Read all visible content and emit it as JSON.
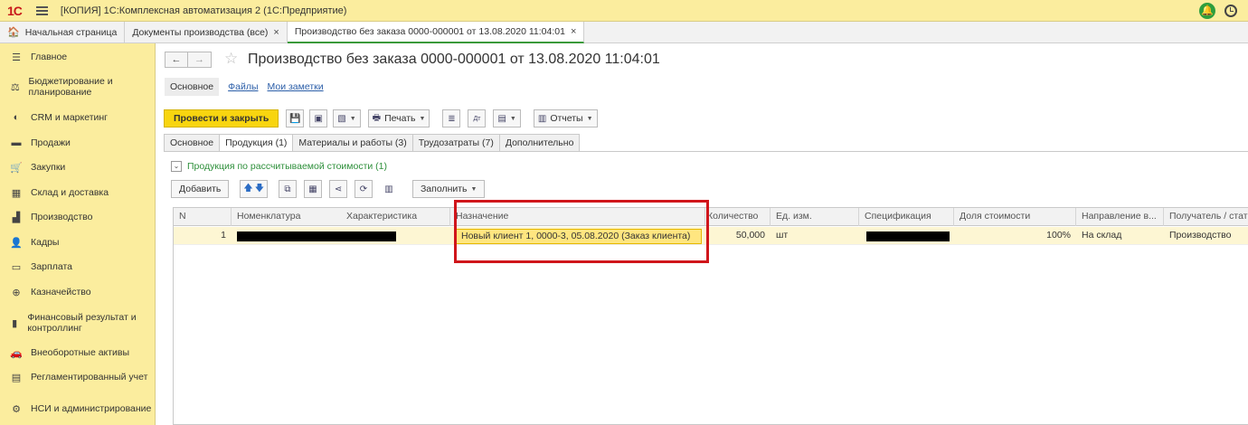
{
  "titlebar": {
    "logo": "1С",
    "title": "[КОПИЯ] 1С:Комплексная автоматизация 2  (1С:Предприятие)"
  },
  "window_tabs": [
    {
      "label": "Начальная страница"
    },
    {
      "label": "Документы производства (все)"
    },
    {
      "label": "Производство без заказа 0000-000001 от 13.08.2020 11:04:01"
    }
  ],
  "sidebar": {
    "items": [
      {
        "label": "Главное",
        "icon": "menu-icon"
      },
      {
        "label": "Бюджетирование и планирование",
        "icon": "budget-icon"
      },
      {
        "label": "CRM и маркетинг",
        "icon": "crm-icon"
      },
      {
        "label": "Продажи",
        "icon": "bag-icon"
      },
      {
        "label": "Закупки",
        "icon": "cart-icon"
      },
      {
        "label": "Склад и доставка",
        "icon": "warehouse-icon"
      },
      {
        "label": "Производство",
        "icon": "factory-icon"
      },
      {
        "label": "Кадры",
        "icon": "person-icon"
      },
      {
        "label": "Зарплата",
        "icon": "money-icon"
      },
      {
        "label": "Казначейство",
        "icon": "treasury-icon"
      },
      {
        "label": "Финансовый результат и контроллинг",
        "icon": "chart-icon"
      },
      {
        "label": "Внеоборотные активы",
        "icon": "assets-icon"
      },
      {
        "label": "Регламентированный учет",
        "icon": "calc-icon"
      },
      {
        "label": "НСИ и администрирование",
        "icon": "gear-icon"
      }
    ]
  },
  "document": {
    "title": "Производство без заказа 0000-000001 от 13.08.2020 11:04:01",
    "subnav": {
      "current": "Основное",
      "files": "Файлы",
      "notes": "Мои заметки"
    }
  },
  "toolbar": {
    "post_close": "Провести и закрыть",
    "print": "Печать",
    "reports": "Отчеты"
  },
  "form_tabs": [
    {
      "label": "Основное"
    },
    {
      "label": "Продукция (1)"
    },
    {
      "label": "Материалы и работы (3)"
    },
    {
      "label": "Трудозатраты (7)"
    },
    {
      "label": "Дополнительно"
    }
  ],
  "group": {
    "label": "Продукция по рассчитываемой стоимости (1)"
  },
  "table_toolbar": {
    "add": "Добавить",
    "fill": "Заполнить"
  },
  "table": {
    "columns": [
      "N",
      "Номенклатура",
      "Характеристика",
      "Назначение",
      "Количество",
      "Ед. изм.",
      "Спецификация",
      "Доля стоимости",
      "Направление в...",
      "Получатель / стать"
    ],
    "rows": [
      {
        "n": "1",
        "purpose": "Новый клиент 1, 0000-3, 05.08.2020 (Заказ клиента)",
        "qty": "50,000",
        "unit": "шт",
        "share": "100%",
        "direction": "На склад",
        "recipient": "Производство"
      }
    ]
  },
  "colors": {
    "accent_yellow": "#fbed9e",
    "primary_button": "#f8d50f",
    "highlight_red": "#d0161b"
  }
}
